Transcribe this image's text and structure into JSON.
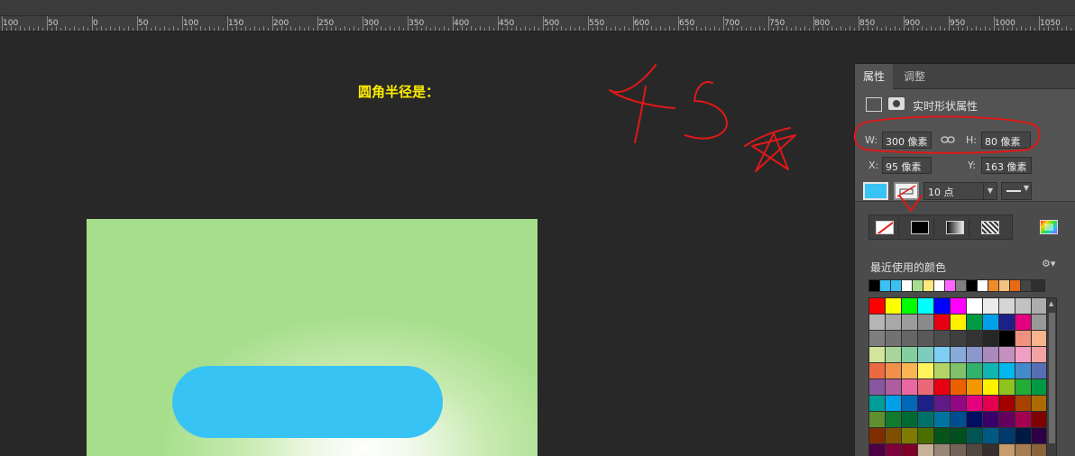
{
  "ruler": {
    "labels": [
      "100",
      "50",
      "0",
      "50",
      "100",
      "150",
      "200",
      "250",
      "300",
      "350",
      "400",
      "450",
      "500",
      "550",
      "600",
      "650",
      "700",
      "750",
      "800",
      "850",
      "900",
      "950",
      "1000",
      "1050"
    ]
  },
  "canvas": {
    "annotation_text": "圆角半径是：",
    "annotation_color": "#ffee00",
    "shape_fill": "#38c3f5"
  },
  "panel": {
    "tabs": [
      {
        "label": "属性",
        "active": true
      },
      {
        "label": "调整",
        "active": false
      }
    ],
    "shape_props_label": "实时形状属性",
    "width": {
      "label": "W:",
      "value": "300 像素"
    },
    "height": {
      "label": "H:",
      "value": "80 像素"
    },
    "x": {
      "label": "X:",
      "value": "95 像素"
    },
    "y": {
      "label": "Y:",
      "value": "163 像素"
    },
    "fill_color": "#38c3f5",
    "stroke_width": "10 点",
    "recent_colors_label": "最近使用的颜色",
    "recent_colors": [
      "#000000",
      "#3ac0f2",
      "#3ac0f2",
      "#ffffff",
      "#a8dd90",
      "#ffe97f",
      "#ffffff",
      "#ff66ff",
      "#7f7f7f",
      "#000000",
      "#ffffff",
      "#f08a2a",
      "#f4c27f",
      "#e76b14",
      "#444444"
    ],
    "swatches": [
      [
        "#ff0000",
        "#ffff00",
        "#00ff00",
        "#00ffff",
        "#0000ff",
        "#ff00ff",
        "#ffffff",
        "#ebebeb",
        "#d6d6d6",
        "#c2c2c2",
        "#adadad"
      ],
      [
        "#b5b5b5",
        "#a8a8a8",
        "#9c9c9c",
        "#8a8a8a",
        "#e60012",
        "#fff100",
        "#009944",
        "#00a0e9",
        "#1d2088",
        "#e4007f",
        "#999999"
      ],
      [
        "#7f7f7f",
        "#727272",
        "#666666",
        "#595959",
        "#4c4c4c",
        "#3f3f3f",
        "#333333",
        "#262626",
        "#000000",
        "#f19180",
        "#f8b48c"
      ],
      [
        "#d3e49b",
        "#a8d69a",
        "#84cfa0",
        "#7ecbc0",
        "#7ecef4",
        "#88abda",
        "#8c97cb",
        "#aa89bd",
        "#c490bf",
        "#f19ec2",
        "#f4a3a5"
      ],
      [
        "#ec6941",
        "#f19149",
        "#f8b551",
        "#fff45c",
        "#b3d465",
        "#80c269",
        "#32b16c",
        "#13b5b1",
        "#00b7ee",
        "#448aca",
        "#556fb5"
      ],
      [
        "#8957a1",
        "#ae5da1",
        "#ea68a2",
        "#eb6877",
        "#e60012",
        "#eb6100",
        "#f39800",
        "#fff100",
        "#8fc31f",
        "#22ac38",
        "#009944"
      ],
      [
        "#009e96",
        "#00a0e9",
        "#0068b7",
        "#1d2088",
        "#601986",
        "#920783",
        "#e4007f",
        "#e5004f",
        "#a40000",
        "#a84200",
        "#ac6a00"
      ],
      [
        "#5f8f2f",
        "#127a2f",
        "#006934",
        "#00706b",
        "#00749e",
        "#004e8f",
        "#000e64",
        "#3a006a",
        "#64005f",
        "#a4004f",
        "#7f0000"
      ],
      [
        "#7f2d00",
        "#7f4f00",
        "#7f7a00",
        "#4a6e00",
        "#05541a",
        "#00501d",
        "#005552",
        "#005982",
        "#003a6c",
        "#001a44",
        "#2c0045"
      ],
      [
        "#4e0046",
        "#7f003a",
        "#7f0027",
        "#c7b299",
        "#998675",
        "#736357",
        "#534741",
        "#362f2d",
        "#c69c6d",
        "#a67c52",
        "#8c6239"
      ]
    ]
  }
}
